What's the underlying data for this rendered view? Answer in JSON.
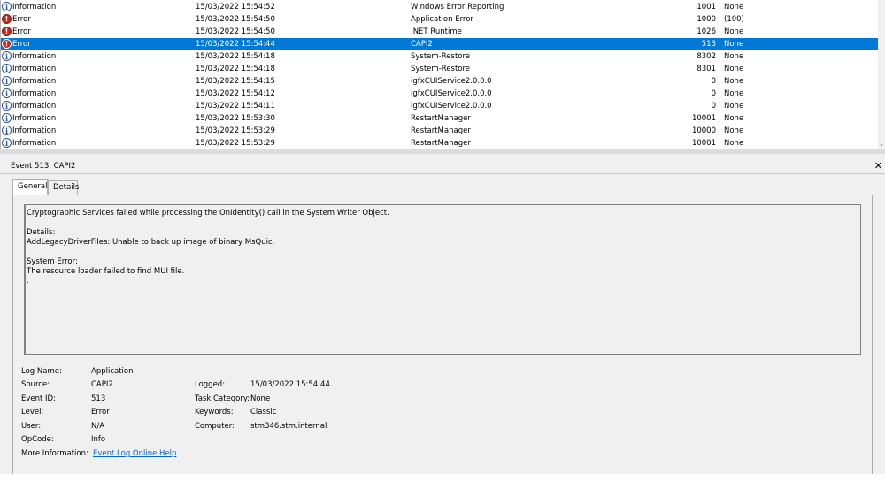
{
  "events": [
    {
      "level": "Information",
      "icon": "info",
      "datetime": "15/03/2022 15:54:52",
      "source": "Windows Error Reporting",
      "event_id": "1001",
      "task_category": "None",
      "selected": false
    },
    {
      "level": "Error",
      "icon": "error",
      "datetime": "15/03/2022 15:54:50",
      "source": "Application Error",
      "event_id": "1000",
      "task_category": "(100)",
      "selected": false
    },
    {
      "level": "Error",
      "icon": "error",
      "datetime": "15/03/2022 15:54:50",
      "source": ".NET Runtime",
      "event_id": "1026",
      "task_category": "None",
      "selected": false
    },
    {
      "level": "Error",
      "icon": "error",
      "datetime": "15/03/2022 15:54:44",
      "source": "CAPI2",
      "event_id": "513",
      "task_category": "None",
      "selected": true
    },
    {
      "level": "Information",
      "icon": "info",
      "datetime": "15/03/2022 15:54:18",
      "source": "System-Restore",
      "event_id": "8302",
      "task_category": "None",
      "selected": false
    },
    {
      "level": "Information",
      "icon": "info",
      "datetime": "15/03/2022 15:54:18",
      "source": "System-Restore",
      "event_id": "8301",
      "task_category": "None",
      "selected": false
    },
    {
      "level": "Information",
      "icon": "info",
      "datetime": "15/03/2022 15:54:15",
      "source": "igfxCUIService2.0.0.0",
      "event_id": "0",
      "task_category": "None",
      "selected": false
    },
    {
      "level": "Information",
      "icon": "info",
      "datetime": "15/03/2022 15:54:12",
      "source": "igfxCUIService2.0.0.0",
      "event_id": "0",
      "task_category": "None",
      "selected": false
    },
    {
      "level": "Information",
      "icon": "info",
      "datetime": "15/03/2022 15:54:11",
      "source": "igfxCUIService2.0.0.0",
      "event_id": "0",
      "task_category": "None",
      "selected": false
    },
    {
      "level": "Information",
      "icon": "info",
      "datetime": "15/03/2022 15:53:30",
      "source": "RestartManager",
      "event_id": "10001",
      "task_category": "None",
      "selected": false
    },
    {
      "level": "Information",
      "icon": "info",
      "datetime": "15/03/2022 15:53:29",
      "source": "RestartManager",
      "event_id": "10000",
      "task_category": "None",
      "selected": false
    },
    {
      "level": "Information",
      "icon": "info",
      "datetime": "15/03/2022 15:53:29",
      "source": "RestartManager",
      "event_id": "10001",
      "task_category": "None",
      "selected": false
    }
  ],
  "details": {
    "header_title": "Event 513, CAPI2",
    "close_glyph": "✕",
    "tabs": [
      "General",
      "Details"
    ],
    "message": "Cryptographic Services failed while processing the OnIdentity() call in the System Writer Object.\n\nDetails:\nAddLegacyDriverFiles: Unable to back up image of binary MsQuic.\n\nSystem Error:\nThe resource loader failed to find MUI file.\n.",
    "properties": {
      "log_name_label": "Log Name:",
      "log_name": "Application",
      "source_label": "Source:",
      "source": "CAPI2",
      "logged_label": "Logged:",
      "logged": "15/03/2022 15:54:44",
      "event_id_label": "Event ID:",
      "event_id": "513",
      "task_category_label": "Task Category:",
      "task_category": "None",
      "level_label": "Level:",
      "level": "Error",
      "keywords_label": "Keywords:",
      "keywords": "Classic",
      "user_label": "User:",
      "user": "N/A",
      "computer_label": "Computer:",
      "computer": "stm346.stm.internal",
      "opcode_label": "OpCode:",
      "opcode": "Info",
      "more_info_label": "More Information:",
      "more_info_link": "Event Log Online Help"
    }
  },
  "colors": {
    "selection": "#0078d7",
    "error": "#c42b1c",
    "info": "#2b5797",
    "link": "#0066cc"
  }
}
